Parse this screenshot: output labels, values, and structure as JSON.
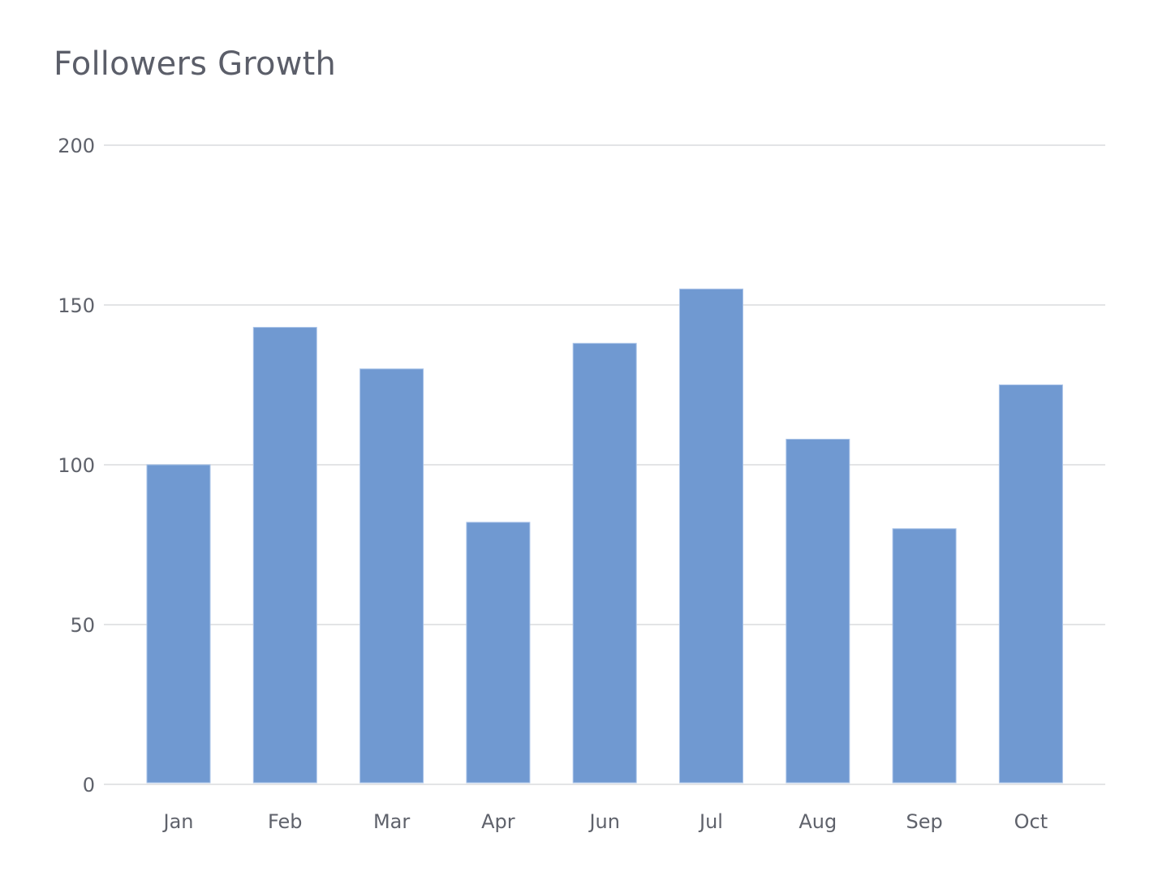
{
  "chart_data": {
    "type": "bar",
    "title": "Followers Growth",
    "xlabel": "",
    "ylabel": "",
    "categories": [
      "Jan",
      "Feb",
      "Mar",
      "Apr",
      "Jun",
      "Jul",
      "Aug",
      "Sep",
      "Oct"
    ],
    "values": [
      100,
      143,
      130,
      82,
      138,
      155,
      108,
      80,
      125
    ],
    "ylim": [
      0,
      200
    ],
    "yticks": [
      0,
      50,
      100,
      150,
      200
    ],
    "grid": true,
    "legend": "none",
    "colors": {
      "bar": "#7099d1",
      "grid": "#e3e4e6",
      "text": "#5f626b"
    }
  }
}
